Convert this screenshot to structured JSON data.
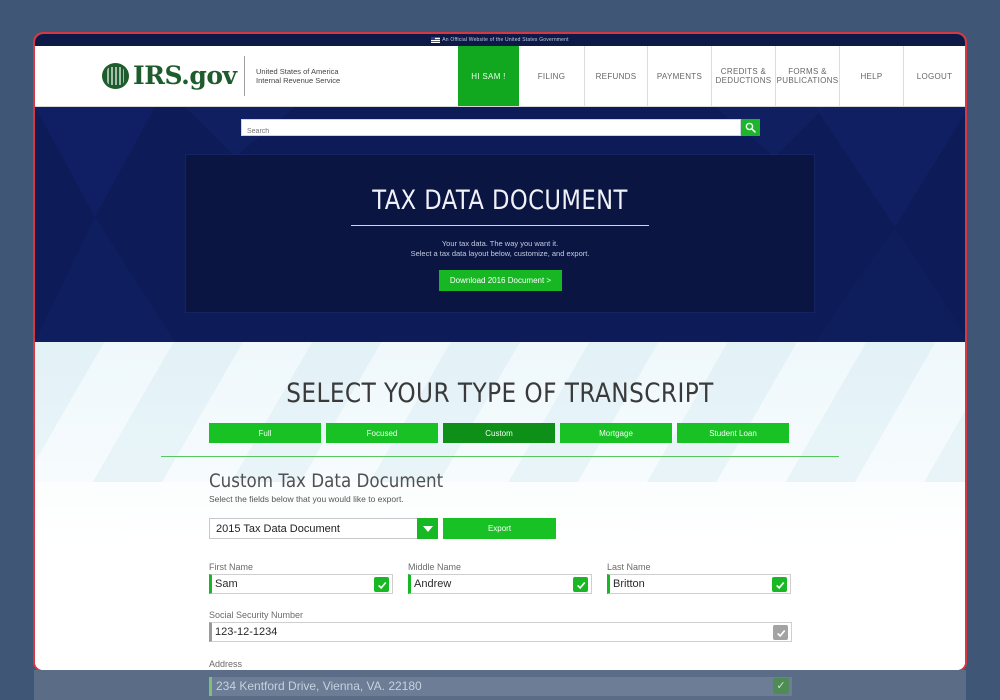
{
  "banner": {
    "text": "An Official Website of the United States Government"
  },
  "header": {
    "logo_text": "IRS.gov",
    "logo_sub_line1": "United States of America",
    "logo_sub_line2": "Internal Revenue Service",
    "nav": [
      {
        "label": "HI SAM !",
        "active": true
      },
      {
        "label": "FILING"
      },
      {
        "label": "REFUNDS"
      },
      {
        "label": "PAYMENTS"
      },
      {
        "label_line1": "CREDITS &",
        "label_line2": "DEDUCTIONS"
      },
      {
        "label_line1": "FORMS &",
        "label_line2": "PUBLICATIONS"
      },
      {
        "label": "HELP"
      },
      {
        "label": "LOGOUT"
      }
    ]
  },
  "search": {
    "placeholder": "Search",
    "icon": "search-icon"
  },
  "hero": {
    "title": "TAX DATA DOCUMENT",
    "line1": "Your tax data. The way you want it.",
    "line2": "Select a tax data layout below, customize, and export.",
    "download_label": "Download 2016 Document >"
  },
  "main": {
    "section_title": "SELECT YOUR TYPE OF TRANSCRIPT",
    "tabs": [
      {
        "label": "Full"
      },
      {
        "label": "Focused"
      },
      {
        "label": "Custom",
        "selected": true
      },
      {
        "label": "Mortgage"
      },
      {
        "label": "Student Loan"
      }
    ],
    "form_title": "Custom Tax Data Document",
    "form_subtitle": "Select the fields below that you would like to export.",
    "document_select": "2015 Tax Data Document",
    "export_label": "Export",
    "fields": {
      "first_name": {
        "label": "First Name",
        "value": "Sam",
        "checked": true
      },
      "middle_name": {
        "label": "Middle Name",
        "value": "Andrew",
        "checked": true
      },
      "last_name": {
        "label": "Last Name",
        "value": "Britton",
        "checked": true
      },
      "ssn": {
        "label": "Social Security Number",
        "value": "123-12-1234",
        "checked": false
      },
      "address": {
        "label": "Address",
        "value": "234 Kentford Drive, Vienna, VA. 22180",
        "checked": true
      }
    }
  },
  "colors": {
    "accent_green": "#18c224",
    "selected_tab": "#0e8f18",
    "hero_navy": "#0d1b58",
    "frame_red": "#d9373f"
  }
}
